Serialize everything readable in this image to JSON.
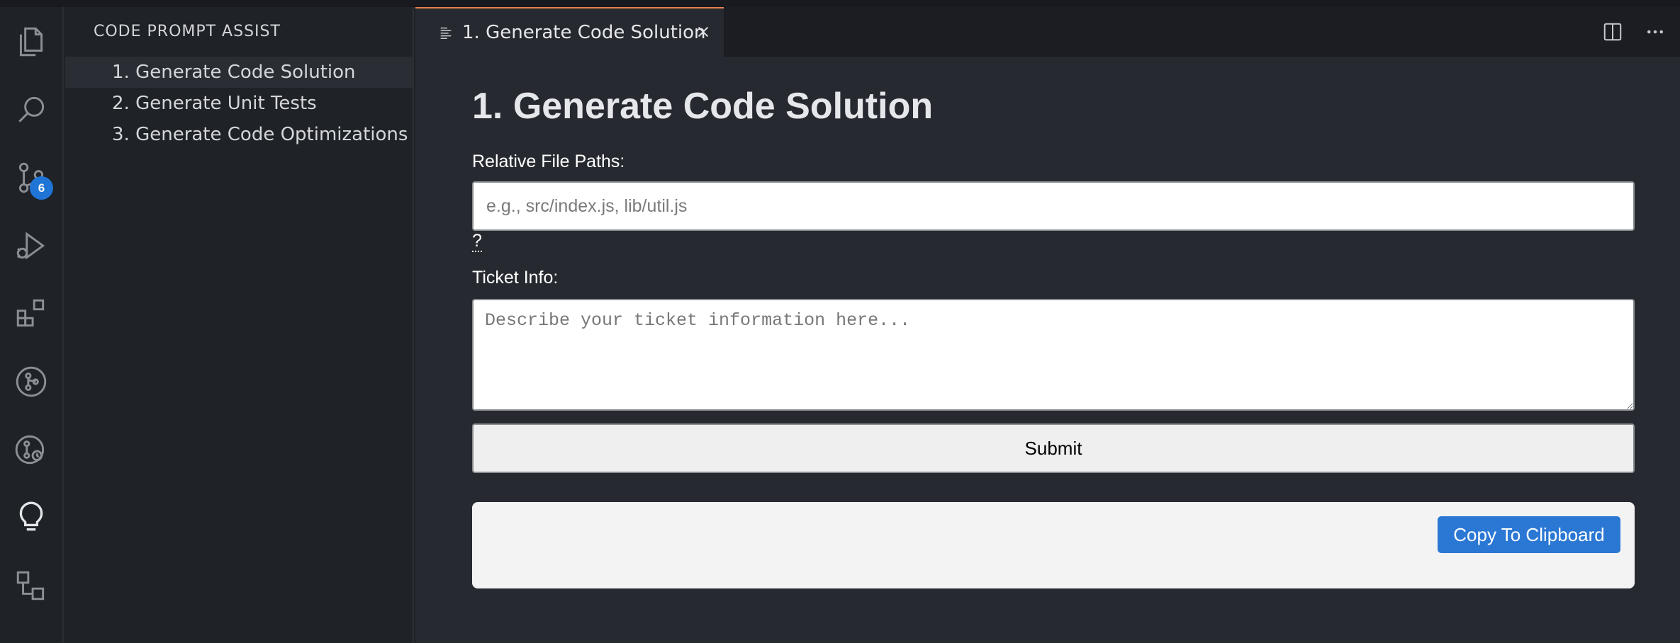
{
  "sidebar": {
    "title": "CODE PROMPT ASSIST",
    "items": [
      {
        "label": "1. Generate Code Solution"
      },
      {
        "label": "2. Generate Unit Tests"
      },
      {
        "label": "3. Generate Code Optimizations"
      }
    ]
  },
  "activity_bar": {
    "icons": [
      "explorer-icon",
      "search-icon",
      "source-control-icon",
      "run-debug-icon",
      "extensions-icon",
      "git-graph-icon",
      "git-history-icon",
      "lightbulb-icon",
      "remote-explorer-icon"
    ],
    "source_control_badge": "6"
  },
  "tab": {
    "label": "1. Generate Code Solution"
  },
  "form": {
    "title": "1. Generate Code Solution",
    "file_paths_label": "Relative File Paths:",
    "file_paths_placeholder": "e.g., src/index.js, lib/util.js",
    "help": "?",
    "ticket_label": "Ticket Info:",
    "ticket_placeholder": "Describe your ticket information here...",
    "submit_label": "Submit",
    "copy_label": "Copy To Clipboard"
  },
  "colors": {
    "accent": "#2b78d4",
    "badge": "#1f74d6",
    "tab_border": "#e8804f"
  }
}
